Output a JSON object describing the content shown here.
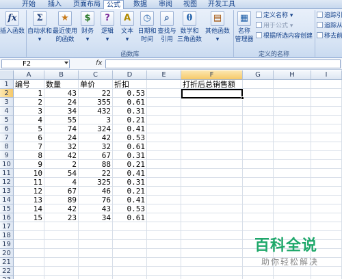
{
  "tabs": [
    "开始",
    "插入",
    "页面布局",
    "公式",
    "数据",
    "审阅",
    "视图",
    "开发工具"
  ],
  "ribbon": {
    "insert_function": "插入函数",
    "autosum": "自动求和",
    "recent": [
      "最近使用",
      "的函数"
    ],
    "financial": "财务",
    "logical": "逻辑",
    "text": "文本",
    "datetime": [
      "日期和",
      "时间"
    ],
    "lookup": [
      "查找与",
      "引用"
    ],
    "math": [
      "数学和",
      "三角函数"
    ],
    "other": "其他函数",
    "function_library_label": "函数库",
    "name_manager": [
      "名称",
      "管理器"
    ],
    "define_name": "定义名称",
    "use_in_formula": "用于公式",
    "create_from_selection": "根据所选内容创建",
    "defined_names_label": "定义的名称",
    "trace_precedents": "追踪引",
    "trace_dependents": "追踪从",
    "remove_arrows": "移去前"
  },
  "formula_bar": {
    "name_box": "F2",
    "fx": "fx",
    "formula": ""
  },
  "columns": [
    "A",
    "B",
    "C",
    "D",
    "E",
    "F",
    "G",
    "H",
    "I"
  ],
  "rows": [
    "1",
    "2",
    "3",
    "4",
    "5",
    "6",
    "7",
    "8",
    "9",
    "10",
    "11",
    "12",
    "13",
    "14",
    "15",
    "16",
    "17",
    "18",
    "19",
    "20",
    "21",
    "22",
    "23"
  ],
  "headers": {
    "a": "编号",
    "b": "数量",
    "c": "单价",
    "d": "折扣",
    "f": "打折后总销售额"
  },
  "data": [
    [
      "1",
      "43",
      "22",
      "0.53"
    ],
    [
      "2",
      "24",
      "355",
      "0.61"
    ],
    [
      "3",
      "34",
      "432",
      "0.31"
    ],
    [
      "4",
      "55",
      "3",
      "0.21"
    ],
    [
      "5",
      "74",
      "324",
      "0.41"
    ],
    [
      "6",
      "24",
      "42",
      "0.53"
    ],
    [
      "7",
      "32",
      "32",
      "0.61"
    ],
    [
      "8",
      "42",
      "67",
      "0.31"
    ],
    [
      "9",
      "2",
      "88",
      "0.21"
    ],
    [
      "10",
      "54",
      "22",
      "0.41"
    ],
    [
      "11",
      "4",
      "325",
      "0.31"
    ],
    [
      "12",
      "67",
      "46",
      "0.21"
    ],
    [
      "13",
      "89",
      "76",
      "0.41"
    ],
    [
      "14",
      "42",
      "43",
      "0.53"
    ],
    [
      "15",
      "23",
      "34",
      "0.61"
    ]
  ],
  "watermark": {
    "logo": "百科全说",
    "sub": "助你轻松解决"
  }
}
